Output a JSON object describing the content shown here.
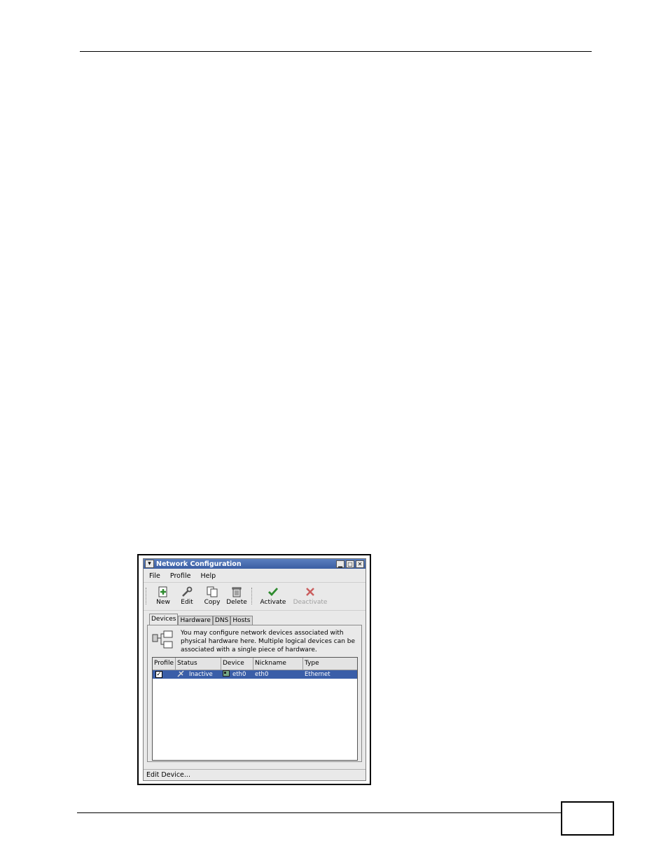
{
  "window": {
    "title": "Network Configuration",
    "title_buttons": {
      "menu_icon": "chevron-down-icon",
      "minimize": "minimize-icon",
      "maximize": "maximize-icon",
      "close": "close-icon"
    }
  },
  "menubar": {
    "file": "File",
    "profile": "Profile",
    "help": "Help"
  },
  "toolbar": {
    "new": "New",
    "edit": "Edit",
    "copy": "Copy",
    "delete": "Delete",
    "activate": "Activate",
    "deactivate": "Deactivate"
  },
  "tabs": {
    "devices": "Devices",
    "hardware": "Hardware",
    "dns": "DNS",
    "hosts": "Hosts"
  },
  "info": {
    "line1": "You may configure network devices associated with",
    "line2": "physical hardware here.  Multiple logical devices can be",
    "line3": "associated with a single piece of hardware."
  },
  "table": {
    "headers": {
      "profile": "Profile",
      "status": "Status",
      "device": "Device",
      "nickname": "Nickname",
      "type": "Type"
    },
    "rows": [
      {
        "profile_checked": "✓",
        "status": "Inactive",
        "device": "eth0",
        "nickname": "eth0",
        "type": "Ethernet"
      }
    ]
  },
  "statusbar": {
    "text": "Edit Device..."
  },
  "colors": {
    "selection": "#3a5ea8",
    "titlebar": "#4a6fb2",
    "activate_check": "#2e8b2e",
    "deactivate_x": "#c03030"
  }
}
